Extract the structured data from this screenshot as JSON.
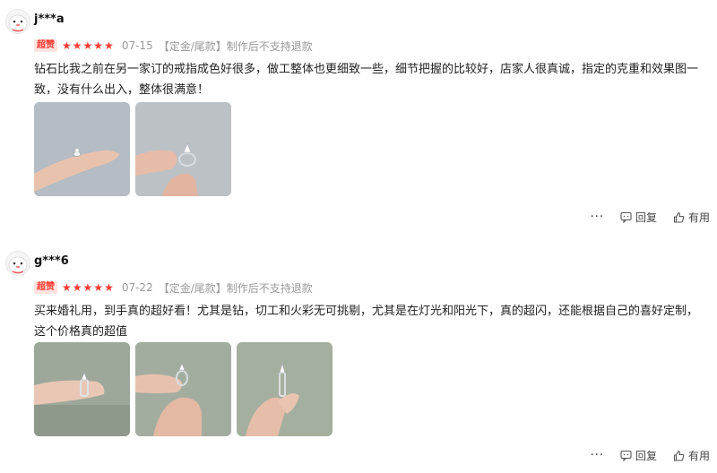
{
  "reviews": [
    {
      "user": "j***a",
      "badge": "超赞",
      "rating": 5,
      "date": "07-15",
      "spec": "【定金/尾款】制作后不支持退款",
      "content": "钻石比我之前在另一家订的戒指成色好很多，做工整体也更细致一些，细节把握的比较好，店家人很真诚，指定的克重和效果图一致，没有什么出入，整体很满意！",
      "photos": [
        "ring-on-fingertip-photo",
        "ring-held-between-fingers-photo"
      ],
      "actions": {
        "more": "···",
        "reply": "回复",
        "useful": "有用"
      }
    },
    {
      "user": "g***6",
      "badge": "超赞",
      "rating": 5,
      "date": "07-22",
      "spec": "【定金/尾款】制作后不支持退款",
      "content": "买来婚礼用，到手真的超好看！尤其是钻，切工和火彩无可挑剔，尤其是在灯光和阳光下，真的超闪，还能根据自己的喜好定制，这个价格真的超值",
      "photos": [
        "ring-on-finger-green-background-photo",
        "ring-held-closeup-photo",
        "ring-pinched-between-fingers-photo"
      ],
      "actions": {
        "more": "···",
        "reply": "回复",
        "useful": "有用"
      }
    }
  ],
  "colors": {
    "accent": "#ff3b30",
    "badge_bg": "#ffe3e0",
    "muted": "#999999"
  }
}
